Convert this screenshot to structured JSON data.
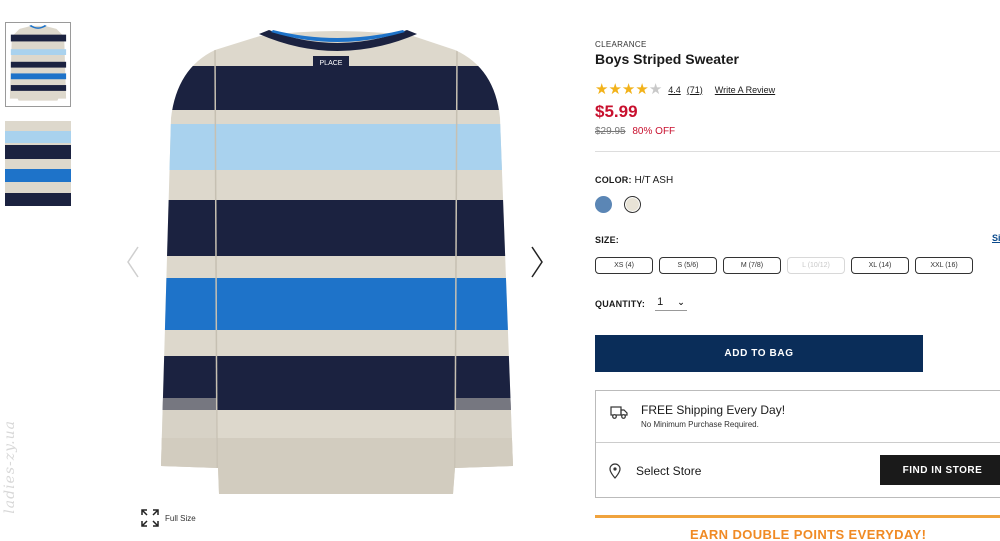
{
  "gallery": {
    "brand_tag": "PLACE",
    "full_size_label": "Full Size",
    "watermark": "ladies-zy.ua"
  },
  "product": {
    "eyebrow": "CLEARANCE",
    "title": "Boys Striped Sweater",
    "rating": 4.4,
    "rating_text": "4.4",
    "review_count": "(71)",
    "write_review": "Write A Review",
    "price": "$5.99",
    "was_price": "$29.95",
    "discount": "80% OFF"
  },
  "color": {
    "label": "COLOR:",
    "selected": "H/T ASH",
    "swatches": [
      "blue-swatch",
      "ash-swatch"
    ]
  },
  "size": {
    "label": "SIZE:",
    "guide_label": "Si",
    "options": [
      {
        "label": "XS (4)",
        "available": true
      },
      {
        "label": "S (5/6)",
        "available": true
      },
      {
        "label": "M (7/8)",
        "available": true
      },
      {
        "label": "L (10/12)",
        "available": false
      },
      {
        "label": "XL (14)",
        "available": true
      },
      {
        "label": "XXL (16)",
        "available": true
      }
    ]
  },
  "quantity": {
    "label": "QUANTITY:",
    "value": "1"
  },
  "actions": {
    "add_to_bag": "ADD TO BAG",
    "find_in_store": "FIND IN STORE"
  },
  "shipping": {
    "title": "FREE Shipping Every Day!",
    "subtitle": "No Minimum Purchase Required.",
    "select_store": "Select Store"
  },
  "promo": {
    "text": "EARN DOUBLE POINTS EVERYDAY!"
  },
  "colors": {
    "price_red": "#c8102e",
    "navy_button": "#0a2d59",
    "promo_orange": "#f08a24",
    "star_gold": "#f2b21a"
  }
}
